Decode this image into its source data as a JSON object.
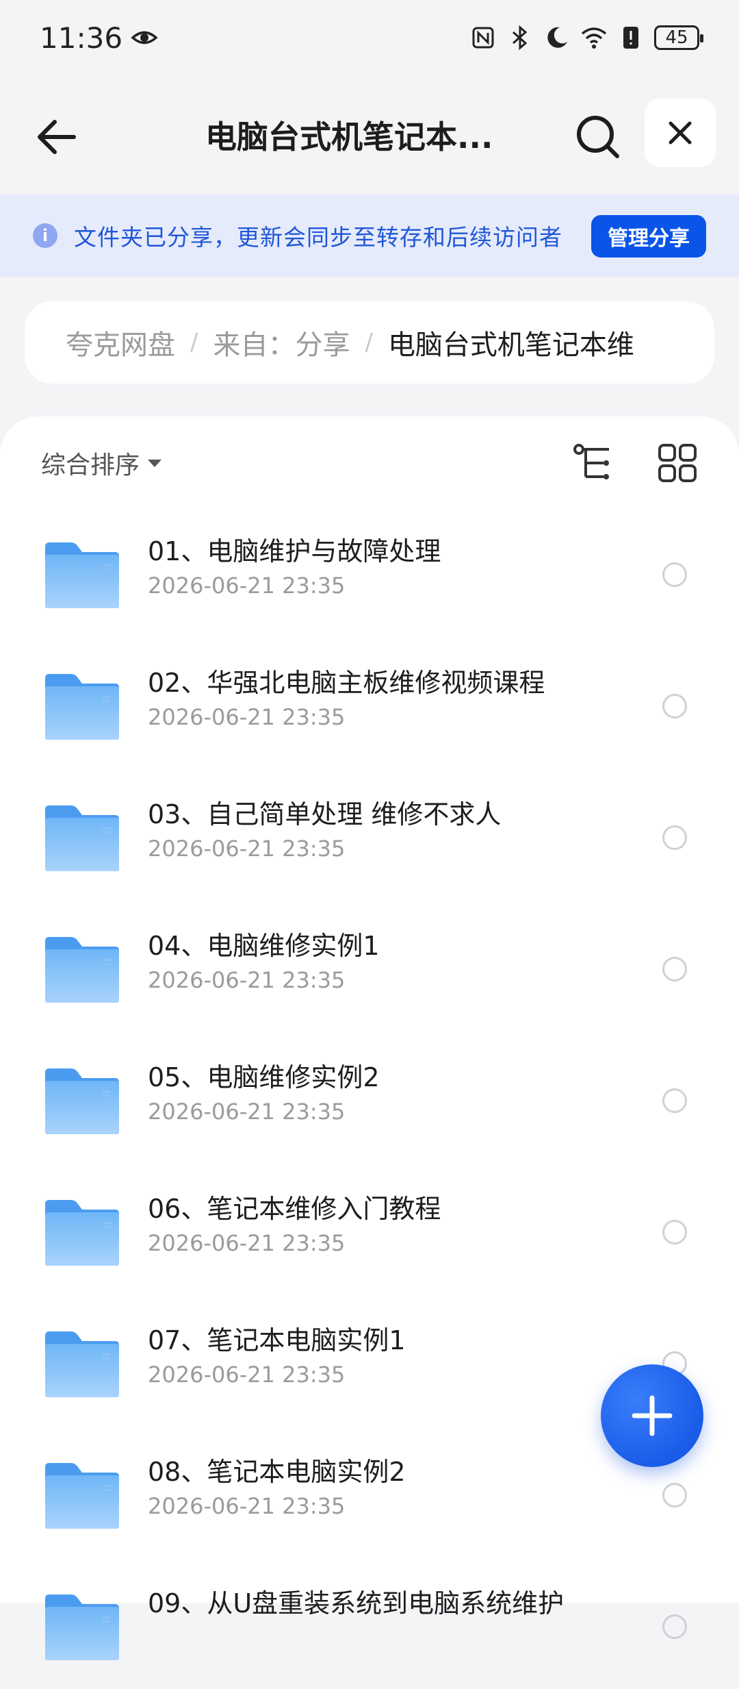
{
  "status_bar": {
    "time": "11:36",
    "battery": "45",
    "icons": [
      "eye-icon",
      "nfc-icon",
      "bluetooth-icon",
      "moon-icon",
      "wifi-icon",
      "alert-icon"
    ]
  },
  "header": {
    "title": "电脑台式机笔记本...",
    "back_icon": "arrow-left-icon",
    "search_icon": "search-icon",
    "close_icon": "close-icon"
  },
  "banner": {
    "info_icon": "i",
    "text": "文件夹已分享，更新会同步至转存和后续访问者",
    "button": "管理分享"
  },
  "breadcrumb": {
    "items": [
      "夸克网盘",
      "来自：分享",
      "电脑台式机笔记本维"
    ],
    "separator": "/"
  },
  "toolbar": {
    "sort_label": "综合排序"
  },
  "files": [
    {
      "name": "01、电脑维护与故障处理",
      "date": "2026-06-21 23:35"
    },
    {
      "name": "02、华强北电脑主板维修视频课程",
      "date": "2026-06-21 23:35"
    },
    {
      "name": "03、自己简单处理 维修不求人",
      "date": "2026-06-21 23:35"
    },
    {
      "name": "04、电脑维修实例1",
      "date": "2026-06-21 23:35"
    },
    {
      "name": "05、电脑维修实例2",
      "date": "2026-06-21 23:35"
    },
    {
      "name": "06、笔记本维修入门教程",
      "date": "2026-06-21 23:35"
    },
    {
      "name": "07、笔记本电脑实例1",
      "date": "2026-06-21 23:35"
    },
    {
      "name": "08、笔记本电脑实例2",
      "date": "2026-06-21 23:35"
    },
    {
      "name": "09、从U盘重装系统到电脑系统维护",
      "date": ""
    }
  ],
  "fab": {
    "icon": "plus-icon"
  },
  "colors": {
    "accent": "#0a55e8",
    "banner_bg": "#e6ebfb",
    "banner_text": "#1f56d9",
    "folder": "#5aa6f2"
  }
}
